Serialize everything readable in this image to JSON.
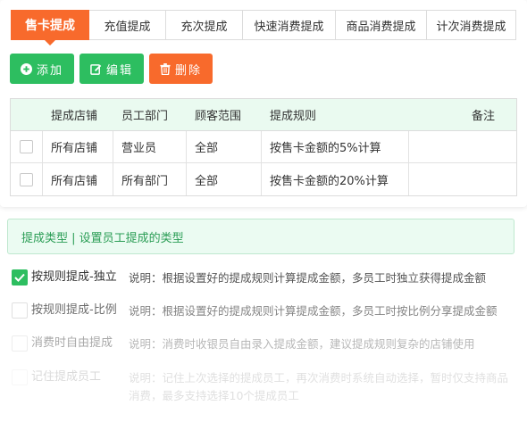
{
  "tabs": [
    {
      "label": "售卡提成",
      "active": true
    },
    {
      "label": "充值提成",
      "active": false
    },
    {
      "label": "充次提成",
      "active": false
    },
    {
      "label": "快速消费提成",
      "active": false
    },
    {
      "label": "商品消费提成",
      "active": false
    },
    {
      "label": "计次消费提成",
      "active": false
    }
  ],
  "toolbar": {
    "add": "添加",
    "edit": "编辑",
    "delete": "删除"
  },
  "table": {
    "headers": [
      "",
      "提成店铺",
      "员工部门",
      "顾客范围",
      "提成规则",
      "备注"
    ],
    "rows": [
      [
        "所有店铺",
        "营业员",
        "全部",
        "按售卡金额的5%计算",
        ""
      ],
      [
        "所有店铺",
        "所有部门",
        "全部",
        "按售卡金额的20%计算",
        ""
      ]
    ]
  },
  "section": {
    "title": "提成类型 | 设置员工提成的类型"
  },
  "options": [
    {
      "label": "按规则提成-独立",
      "desc": "说明：根据设置好的提成规则计算提成金额，多员工时独立获得提成金额",
      "checked": true
    },
    {
      "label": "按规则提成-比例",
      "desc": "说明：根据设置好的提成规则计算提成金额，多员工时按比例分享提成金额",
      "checked": false
    },
    {
      "label": "消费时自由提成",
      "desc": "说明：消费时收银员自由录入提成金额，建议提成规则复杂的店铺使用",
      "checked": false
    },
    {
      "label": "记住提成员工",
      "desc": "说明：记住上次选择的提成员工，再次消费时系统自动选择，暂时仅支持商品消费，最多支持选择10个提成员工",
      "checked": false
    }
  ],
  "colors": {
    "accent": "#f86a2c",
    "green": "#2dbe60",
    "header_bg": "#eafaf0"
  }
}
